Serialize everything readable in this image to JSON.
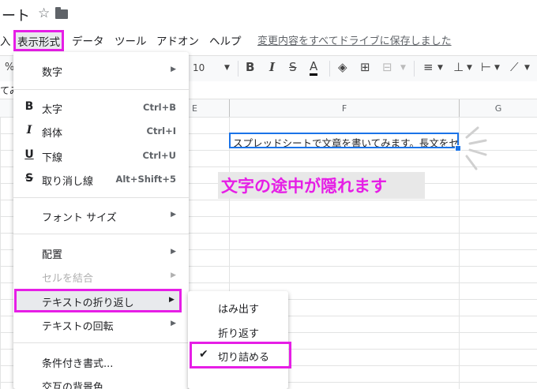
{
  "title": {
    "doc_name": "ート",
    "star_icon": "star-outline-icon",
    "folder_icon": "folder-icon"
  },
  "menubar": {
    "items": [
      "入",
      "表示形式",
      "データ",
      "ツール",
      "アドオン",
      "ヘルプ"
    ],
    "save_status": "変更内容をすべてドライブに保存しました"
  },
  "toolbar": {
    "percent": "%",
    "font_size": "10",
    "bold": "B",
    "italic": "I",
    "strike": "S",
    "text_color": "A"
  },
  "formula": {
    "text": "てみ"
  },
  "columns": [
    "E",
    "F",
    "G"
  ],
  "cell": {
    "text": "スプレッドシートで文章を書いてみます。長文をセ"
  },
  "annotation": {
    "text": "文字の途中が隠れます"
  },
  "format_menu": {
    "number": "数字",
    "bold": {
      "label": "太字",
      "shortcut": "Ctrl+B",
      "icon": "B"
    },
    "italic": {
      "label": "斜体",
      "shortcut": "Ctrl+I",
      "icon": "I"
    },
    "underline": {
      "label": "下線",
      "shortcut": "Ctrl+U",
      "icon": "U"
    },
    "strikethrough": {
      "label": "取り消し線",
      "shortcut": "Alt+Shift+5",
      "icon": "S"
    },
    "font_size": "フォント サイズ",
    "align": "配置",
    "merge": "セルを結合",
    "wrap": "テキストの折り返し",
    "rotate": "テキストの回転",
    "conditional": "条件付き書式...",
    "alternating": "交互の背景色"
  },
  "wrap_submenu": {
    "overflow": "はみ出す",
    "wrap": "折り返す",
    "clip": "切り詰める",
    "selected": "clip"
  },
  "highlight_color": "#e61ee6",
  "selection_color": "#1a73e8"
}
